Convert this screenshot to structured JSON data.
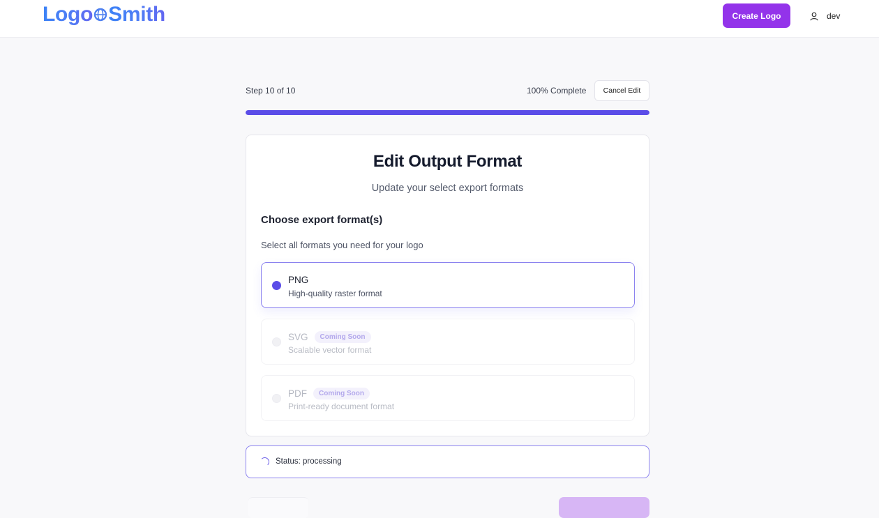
{
  "header": {
    "logo": {
      "part1": "Logo",
      "part2": "Smith",
      "icon": "globe-icon"
    },
    "create_button": "Create Logo",
    "user": {
      "icon": "user-icon",
      "name": "dev"
    }
  },
  "progress": {
    "step_label": "Step 10 of 10",
    "percent_label": "100% Complete",
    "percent_value": 100,
    "cancel_button": "Cancel Edit"
  },
  "card": {
    "title": "Edit Output Format",
    "subtitle": "Update your select export formats",
    "section_title": "Choose export format(s)",
    "section_description": "Select all formats you need for your logo",
    "options": [
      {
        "name": "PNG",
        "description": "High-quality raster format",
        "badge": "",
        "selected": true,
        "disabled": false
      },
      {
        "name": "SVG",
        "description": "Scalable vector format",
        "badge": "Coming Soon",
        "selected": false,
        "disabled": true
      },
      {
        "name": "PDF",
        "description": "Print-ready document format",
        "badge": "Coming Soon",
        "selected": false,
        "disabled": true
      }
    ]
  },
  "status": {
    "text": "Status: processing",
    "icon": "spinner-icon"
  },
  "colors": {
    "brand": "#9333ea",
    "accent": "#5b4de8",
    "logo_blue": "#3b82f6"
  }
}
